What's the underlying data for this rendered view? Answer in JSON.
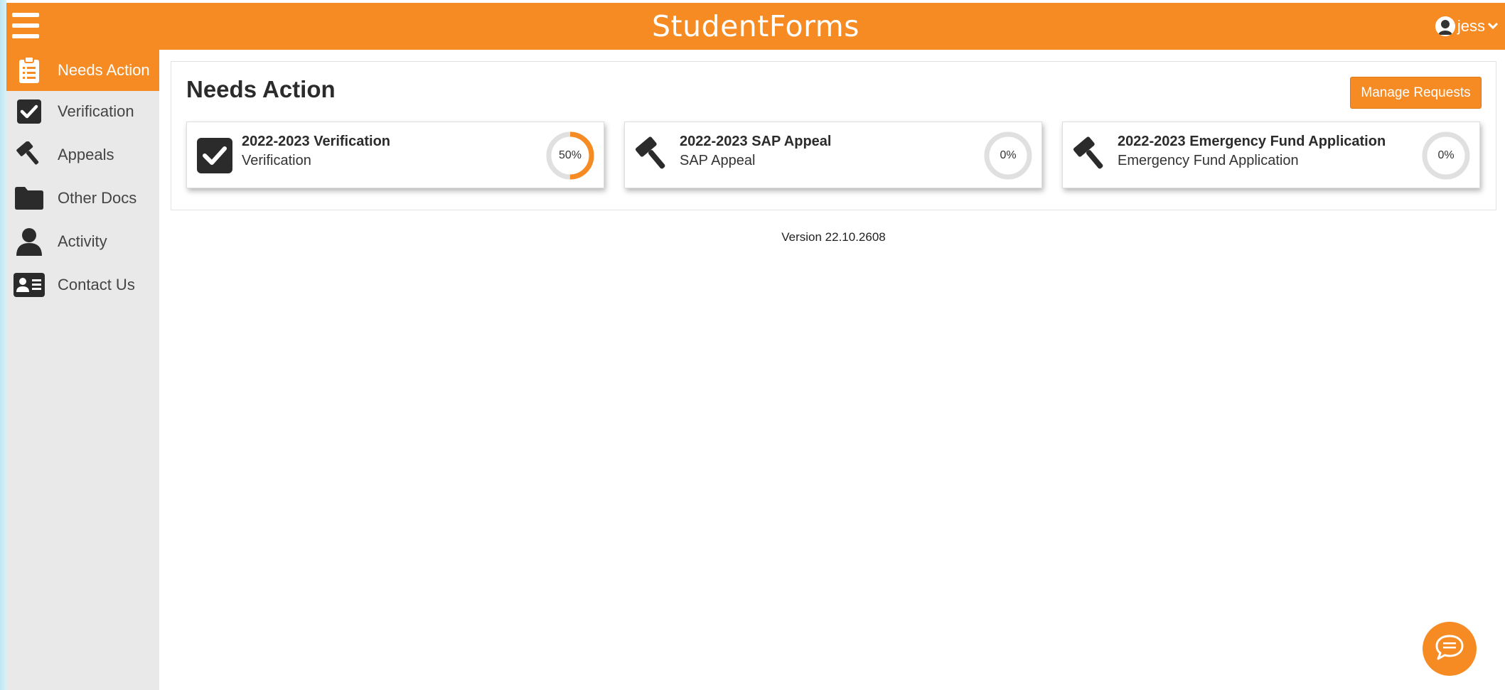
{
  "header": {
    "brand": "StudentForms",
    "user_name": "jess",
    "menu_icon": "hamburger-icon",
    "accent_color": "#f68b24"
  },
  "sidebar": {
    "items": [
      {
        "label": "Needs Action",
        "icon": "clipboard-list-icon",
        "active": true
      },
      {
        "label": "Verification",
        "icon": "checkbox-icon",
        "active": false
      },
      {
        "label": "Appeals",
        "icon": "gavel-icon",
        "active": false
      },
      {
        "label": "Other Docs",
        "icon": "folder-icon",
        "active": false
      },
      {
        "label": "Activity",
        "icon": "user-icon",
        "active": false
      },
      {
        "label": "Contact Us",
        "icon": "contact-card-icon",
        "active": false
      }
    ]
  },
  "main": {
    "title": "Needs Action",
    "manage_button": "Manage Requests",
    "cards": [
      {
        "title": "2022-2023 Verification",
        "subtitle": "Verification",
        "progress_label": "50%",
        "progress": 0.5,
        "icon": "checkbox-icon"
      },
      {
        "title": "2022-2023 SAP Appeal",
        "subtitle": "SAP Appeal",
        "progress_label": "0%",
        "progress": 0,
        "icon": "gavel-icon"
      },
      {
        "title": "2022-2023 Emergency Fund Application",
        "subtitle": "Emergency Fund Application",
        "progress_label": "0%",
        "progress": 0,
        "icon": "gavel-icon"
      }
    ]
  },
  "footer": {
    "version": "Version 22.10.2608"
  },
  "chat": {
    "icon": "chat-bubble-icon"
  }
}
